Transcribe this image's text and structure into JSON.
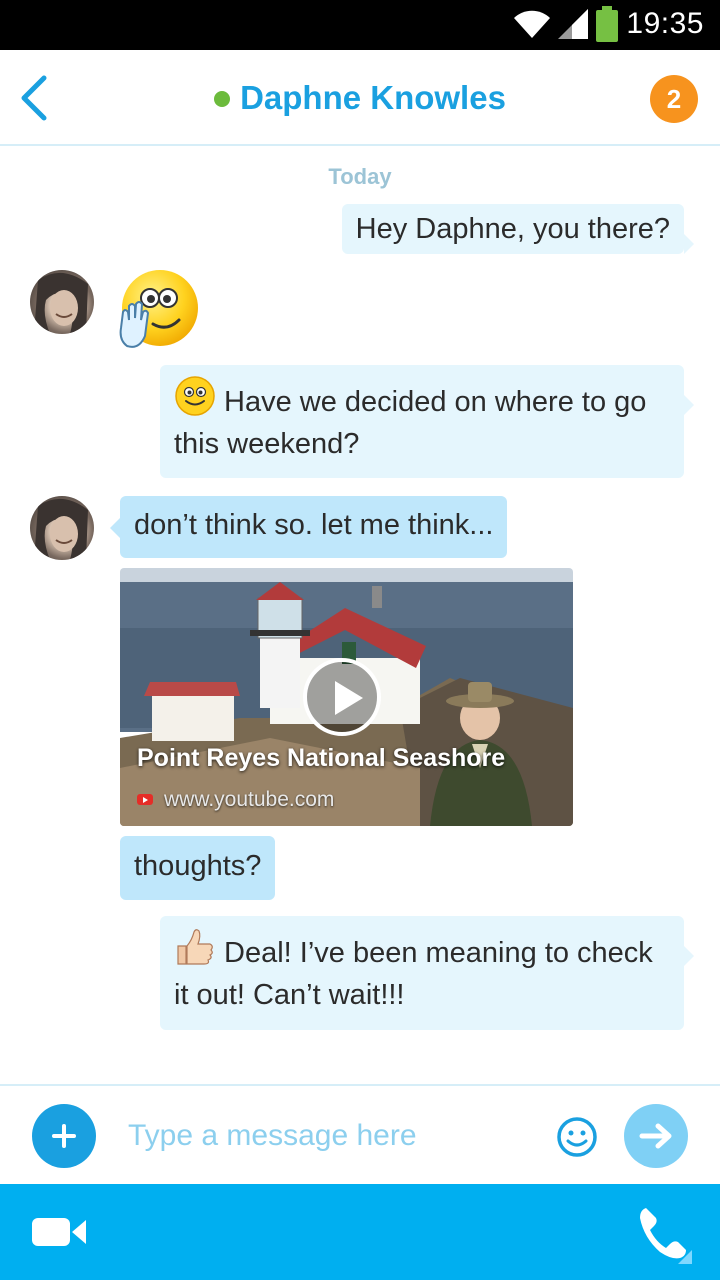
{
  "status_bar": {
    "time": "19:35",
    "icons": [
      "wifi-icon",
      "signal-icon",
      "battery-icon"
    ]
  },
  "header": {
    "contact_name": "Daphne Knowles",
    "unread_count": "2",
    "presence_color": "#6cbb3c",
    "accent": "#1aa0e0",
    "badge_color": "#f7931e"
  },
  "chat": {
    "day_label": "Today",
    "messages": [
      {
        "from": "me",
        "text": "Hey Daphne, you there?"
      },
      {
        "from": "contact",
        "emoticon": "wave-emoticon"
      },
      {
        "from": "me",
        "emoticon": "smile-emoticon",
        "text": "Have we decided on where to go this weekend?"
      },
      {
        "from": "contact",
        "text": "don’t think so. let me think..."
      },
      {
        "from": "contact",
        "video": {
          "title": "Point Reyes National Seashore",
          "url": "www.youtube.com"
        }
      },
      {
        "from": "contact",
        "text": "thoughts?"
      },
      {
        "from": "me",
        "emoticon": "thumbs-up-emoticon",
        "text": "Deal! I’ve been meaning to check it out! Can’t wait!!!"
      }
    ]
  },
  "compose": {
    "placeholder": "Type a message here"
  },
  "bottom_bar": {
    "color": "#00aff0",
    "icons": [
      "video-call-icon",
      "phone-icon"
    ]
  }
}
